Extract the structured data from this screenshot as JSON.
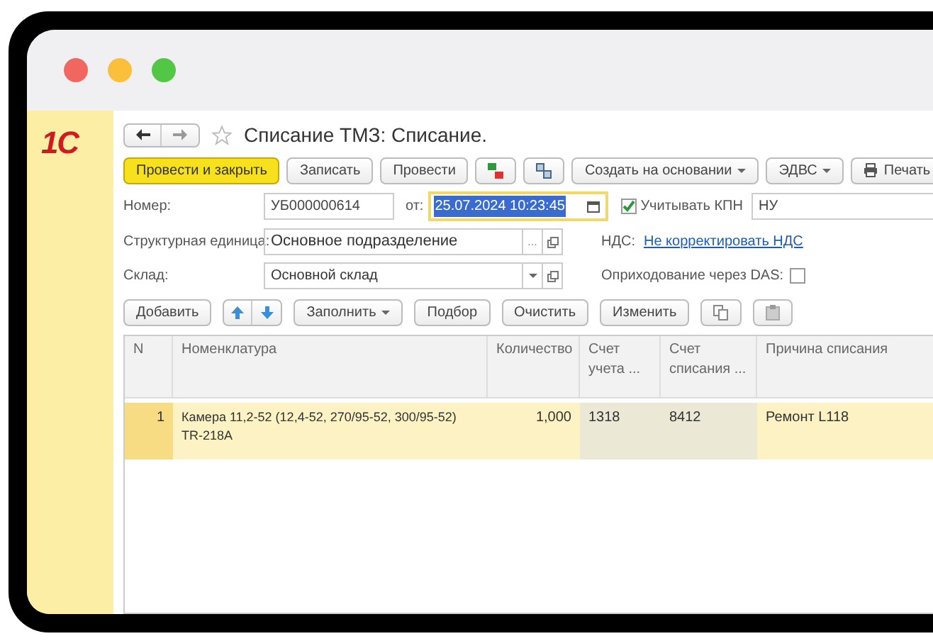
{
  "window": {
    "controls": [
      {
        "color": "#f26660"
      },
      {
        "color": "#fbbf3c"
      },
      {
        "color": "#52c746"
      }
    ]
  },
  "sidebar": {
    "logo": "1С"
  },
  "title": "Списание ТМЗ: Списание.",
  "command_bar": [
    {
      "label": "Провести и закрыть",
      "kind": "primary"
    },
    {
      "label": "Записать",
      "kind": "button"
    },
    {
      "label": "Провести",
      "kind": "button"
    },
    {
      "kind": "dtkt"
    },
    {
      "kind": "structure"
    },
    {
      "label": "Создать на основании",
      "kind": "menu"
    },
    {
      "label": "ЭДВС",
      "kind": "menu"
    },
    {
      "label": "Печать",
      "kind": "print"
    }
  ],
  "form": {
    "number_label": "Номер:",
    "number": "УБ000000614",
    "date_label": "от:",
    "date": "25.07.2024 10:23:45",
    "kpn": {
      "label": "Учитывать КПН",
      "checked": true
    },
    "kpn_value": "НУ",
    "unit_label": "Структурная единица:",
    "unit": "Основное подразделение",
    "unit_select": "...",
    "vat_label": "НДС:",
    "vat_link": "Не корректировать НДС",
    "warehouse_label": "Склад:",
    "warehouse": "Основной склад",
    "das": {
      "label": "Оприходование через DAS:",
      "checked": false
    }
  },
  "table_bar": [
    {
      "label": "Добавить",
      "kind": "button"
    },
    {
      "kind": "arrows"
    },
    {
      "label": "Заполнить",
      "kind": "menu"
    },
    {
      "label": "Подбор",
      "kind": "button"
    },
    {
      "label": "Очистить",
      "kind": "button"
    },
    {
      "label": "Изменить",
      "kind": "button"
    },
    {
      "kind": "copy"
    },
    {
      "kind": "paste"
    }
  ],
  "table": {
    "columns": [
      "N",
      "Номенклатура",
      "Количество",
      "Счет учета ...",
      "Счет списания ...",
      "Причина списания"
    ],
    "rows": [
      {
        "selected": true,
        "cells": [
          "1",
          "Камера 11,2-52 (12,4-52, 270/95-52, 300/95-52) TR-218A",
          "1,000",
          "1318",
          "8412",
          "Ремонт L118"
        ]
      }
    ]
  }
}
